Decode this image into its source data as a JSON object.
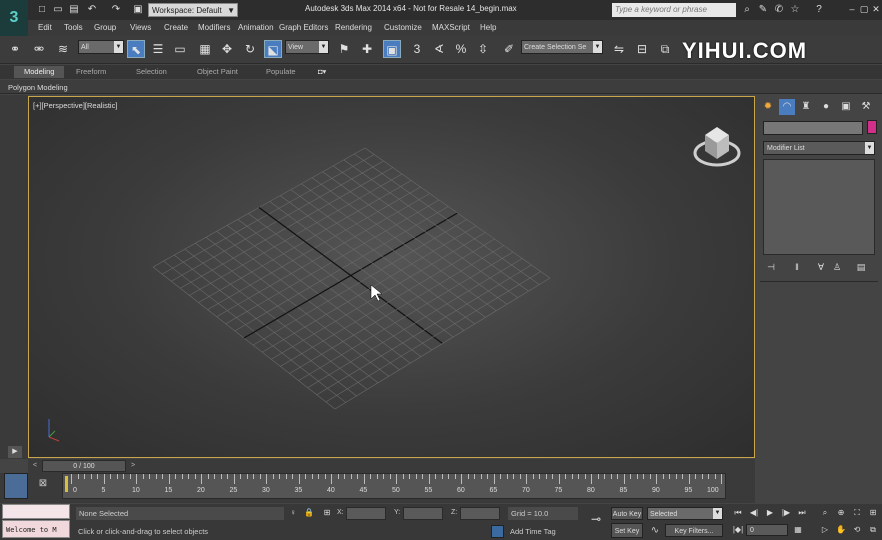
{
  "title_bar": {
    "workspace": "Workspace: Default",
    "app_title": "Autodesk 3ds Max 2014 x64  -  Not for Resale   14_begin.max",
    "search_placeholder": "Type a keyword or phrase"
  },
  "menu": [
    "Edit",
    "Tools",
    "Group",
    "Views",
    "Create",
    "Modifiers",
    "Animation",
    "Graph Editors",
    "Rendering",
    "Customize",
    "MAXScript",
    "Help"
  ],
  "toolbar": {
    "selection_filter": "All",
    "ref_coord": "View",
    "named_selection": "Create Selection Se"
  },
  "watermark": "YIHUI.COM",
  "ribbon": {
    "tabs": [
      "Modeling",
      "Freeform",
      "Selection",
      "Object Paint",
      "Populate"
    ],
    "active_tab": "Modeling",
    "panel_label": "Polygon Modeling"
  },
  "viewport": {
    "label": "[+][Perspective][Realistic]"
  },
  "command_panel": {
    "modifier_list": "Modifier List",
    "name_color": "#d0308a"
  },
  "time_slider": {
    "position": "0 / 100"
  },
  "track_bar": {
    "ticks": [
      "0",
      "5",
      "10",
      "15",
      "20",
      "25",
      "30",
      "35",
      "40",
      "45",
      "50",
      "55",
      "60",
      "65",
      "70",
      "75",
      "80",
      "85",
      "90",
      "95",
      "100"
    ]
  },
  "status": {
    "maxscript": "Welcome to M",
    "selection": "None Selected",
    "prompt": "Click or click-and-drag to select objects",
    "x_label": "X:",
    "y_label": "Y:",
    "z_label": "Z:",
    "grid": "Grid = 10.0",
    "add_time_tag": "Add Time Tag",
    "auto_key": "Auto Key",
    "set_key": "Set Key",
    "key_mode": "Selected",
    "key_filters": "Key Filters...",
    "frame": "0"
  }
}
